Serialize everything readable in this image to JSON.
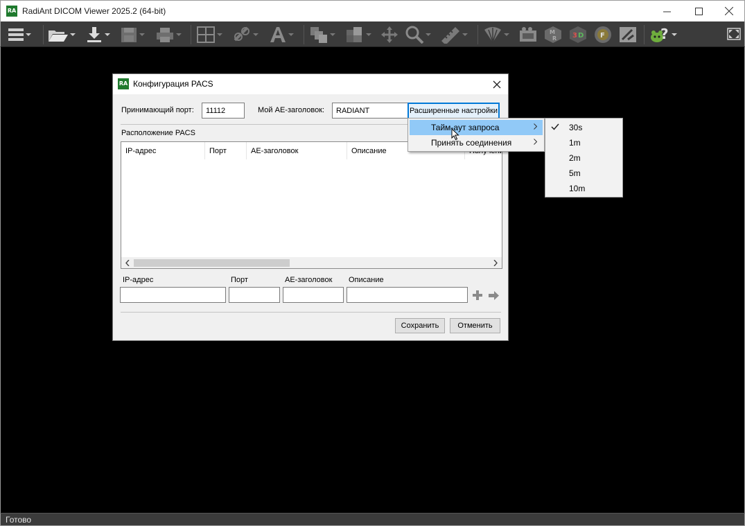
{
  "window": {
    "title": "RadiAnt DICOM Viewer 2025.2 (64-bit)",
    "logo_text": "RA"
  },
  "toolbar": {
    "icons": [
      "menu-icon",
      "open-folder-icon",
      "download-icon",
      "save-icon",
      "print-icon",
      "layout-grid-icon",
      "link-icon",
      "text-annotation-icon",
      "series-icon",
      "window-level-icon",
      "pan-icon",
      "zoom-icon",
      "measure-icon",
      "mpr-fan-icon",
      "cine-icon",
      "mpr-icon",
      "3d-icon",
      "fusion-icon",
      "tools-icon",
      "help-icon",
      "fullscreen-icon"
    ]
  },
  "dialog": {
    "title": "Конфигурация PACS",
    "logo_text": "RA",
    "port_label": "Принимающий порт:",
    "port_value": "11112",
    "ae_label": "Мой AE-заголовок:",
    "ae_value": "RADIANT",
    "advanced_button": "Расширенные настройки",
    "pacs_location_label": "Расположение PACS",
    "table_headers": [
      "IP-адрес",
      "Порт",
      "AE-заголовок",
      "Описание",
      "Получение"
    ],
    "form": {
      "ip_label": "IP-адрес",
      "port_label": "Порт",
      "ae_label": "AE-заголовок",
      "desc_label": "Описание",
      "ip_value": "",
      "port_value": "",
      "ae_value": "",
      "desc_value": ""
    },
    "save_button": "Сохранить",
    "cancel_button": "Отменить"
  },
  "advanced_menu": {
    "items": [
      {
        "label": "Тайм-аут запроса",
        "has_submenu": true,
        "active": true
      },
      {
        "label": "Принять соединения",
        "has_submenu": true,
        "active": false
      }
    ]
  },
  "timeout_submenu": {
    "items": [
      {
        "label": "30s",
        "checked": true
      },
      {
        "label": "1m",
        "checked": false
      },
      {
        "label": "2m",
        "checked": false
      },
      {
        "label": "5m",
        "checked": false
      },
      {
        "label": "10m",
        "checked": false
      }
    ]
  },
  "statusbar": {
    "text": "Готово"
  },
  "colors": {
    "toolbar_bg": "#3b3b3b",
    "menu_highlight": "#91c9f7",
    "focus_border": "#0078d7",
    "logo_green": "#1f7a2e"
  }
}
